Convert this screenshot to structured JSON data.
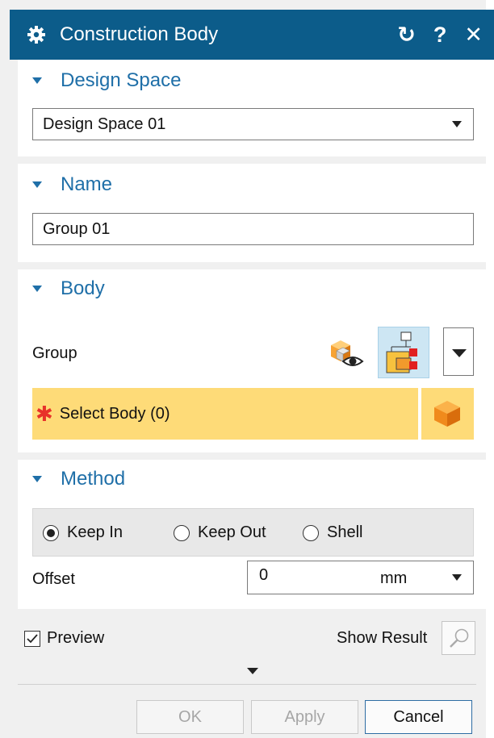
{
  "window": {
    "title": "Construction Body"
  },
  "title_icons": {
    "reset": "↻",
    "help": "?",
    "close": "✕"
  },
  "design_space": {
    "header": "Design Space",
    "selected": "Design Space 01"
  },
  "name_section": {
    "header": "Name",
    "value": "Group 01"
  },
  "body": {
    "header": "Body",
    "group_label": "Group",
    "select_label": "Select Body (0)",
    "required_mark": "✱"
  },
  "method": {
    "header": "Method",
    "options": [
      "Keep In",
      "Keep Out",
      "Shell"
    ],
    "selected": "Keep In",
    "offset_label": "Offset",
    "offset_value": "0",
    "offset_unit": "mm"
  },
  "footer": {
    "preview_label": "Preview",
    "preview_checked": true,
    "show_result_label": "Show Result",
    "ok_label": "OK",
    "apply_label": "Apply",
    "cancel_label": "Cancel"
  },
  "colors": {
    "title_bar": "#0c5c8a",
    "section_header": "#1f6fa8",
    "select_highlight": "#fedb78",
    "required": "#e8322a"
  }
}
